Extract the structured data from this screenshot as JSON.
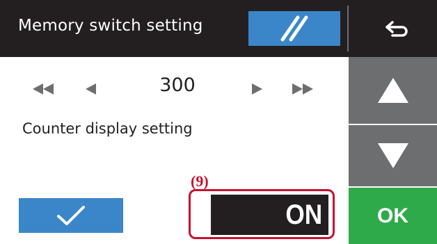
{
  "header": {
    "title": "Memory switch setting",
    "hatch_icon": "hatch-icon",
    "back_icon": "return-arrow-icon"
  },
  "setting": {
    "number": "300",
    "label": "Counter display setting",
    "nav_icons": [
      "double-left-arrow-icon",
      "left-arrow-icon",
      "right-arrow-icon",
      "double-right-arrow-icon"
    ]
  },
  "controls": {
    "check_icon": "checkmark-icon",
    "toggle_value": "ON",
    "callout_label": "(9)",
    "ok_label": "OK",
    "scroll_up_icon": "up-triangle-icon",
    "scroll_down_icon": "down-triangle-icon"
  },
  "colors": {
    "header_bg": "#231f20",
    "accent_blue": "#3b86c8",
    "ok_green": "#2eaa4a",
    "scroll_gray": "#6d6e70",
    "callout_red": "#c8102e"
  }
}
